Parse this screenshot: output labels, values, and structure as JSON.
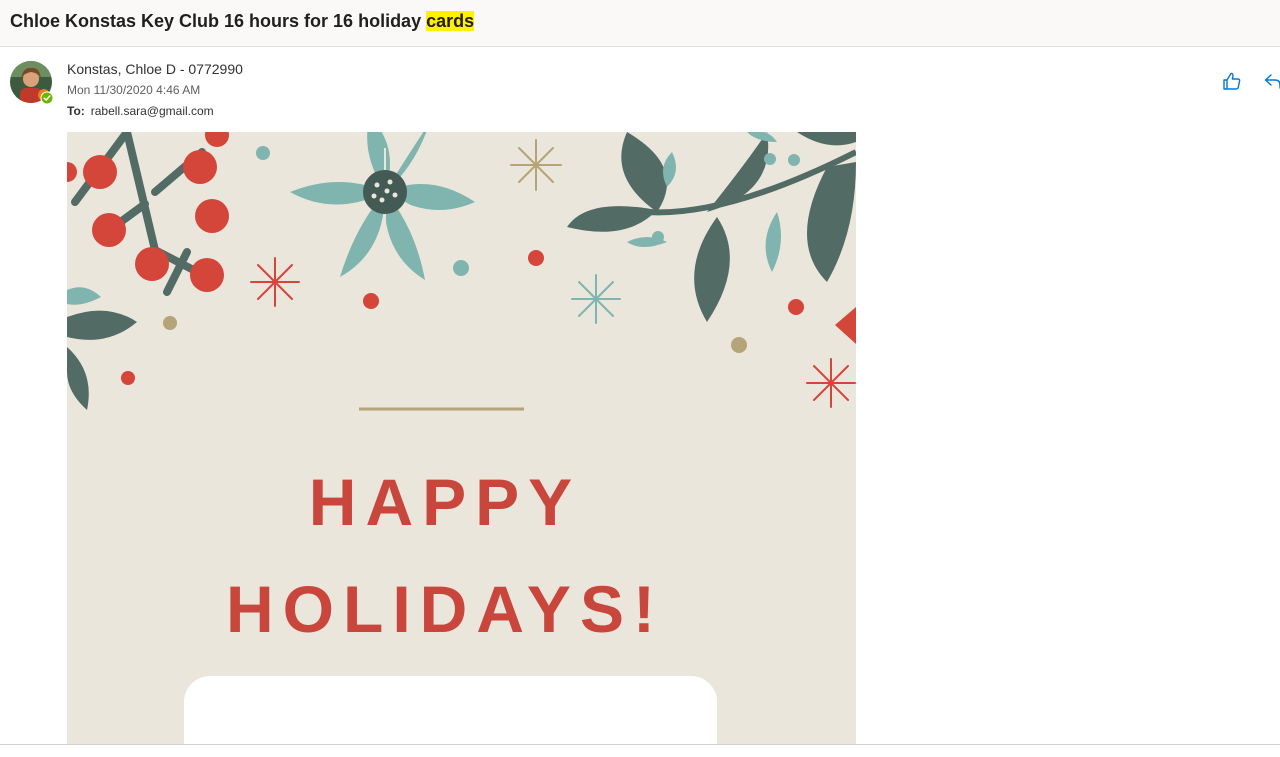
{
  "email": {
    "subject_prefix": "Chloe Konstas Key Club 16 hours for 16 holiday ",
    "subject_highlight": "cards",
    "sender": "Konstas, Chloe D - 0772990",
    "date": "Mon 11/30/2020 4:46 AM",
    "to_label": "To:",
    "to_address": "rabell.sara@gmail.com"
  },
  "card": {
    "line1": "HAPPY",
    "line2": "HOLIDAYS!"
  },
  "colors": {
    "accent_blue": "#0078d4",
    "card_bg": "#ebe6dc",
    "berry_red": "#d4453a",
    "leaf_green": "#536b65",
    "flower_teal": "#7fb5ae",
    "gold": "#b3a577"
  },
  "icons": {
    "like": "thumbs-up-icon",
    "reply": "reply-icon",
    "presence": "presence-available-icon"
  }
}
